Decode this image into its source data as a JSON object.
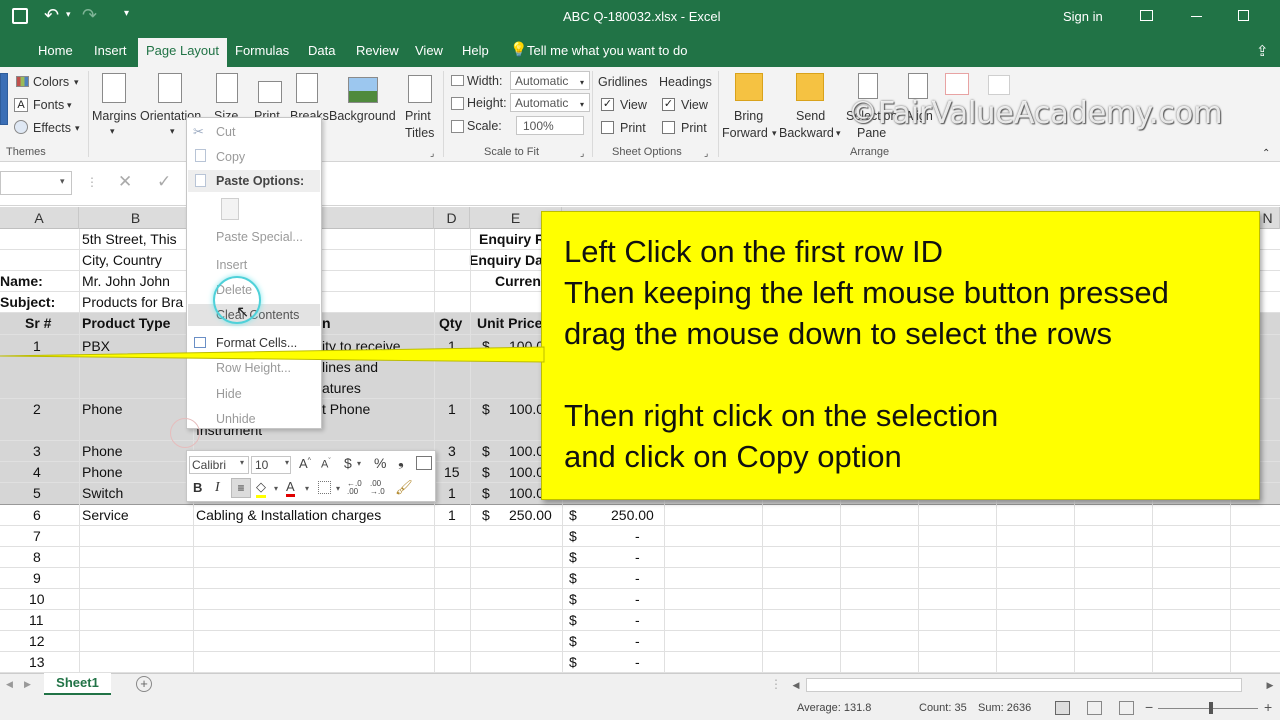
{
  "window": {
    "title": "ABC Q-180032.xlsx  -  Excel",
    "sign_in": "Sign in"
  },
  "tabs": [
    "Home",
    "Insert",
    "Page Layout",
    "Formulas",
    "Data",
    "Review",
    "View",
    "Help"
  ],
  "tell_me": "Tell me what you want to do",
  "ribbon": {
    "themes": {
      "colors": "Colors",
      "fonts": "Fonts",
      "effects": "Effects",
      "group": "Themes"
    },
    "page_setup": {
      "margins": "Margins",
      "orientation": "Orientation",
      "size": "Size",
      "print_area": "Print",
      "breaks": "Breaks",
      "background": "Background",
      "print_titles_1": "Print",
      "print_titles_2": "Titles"
    },
    "scale": {
      "width_label": "Width:",
      "width_val": "Automatic",
      "height_label": "Height:",
      "height_val": "Automatic",
      "scale_label": "Scale:",
      "scale_val": "100%",
      "group": "Scale to Fit"
    },
    "sheet_options": {
      "gridlines": "Gridlines",
      "headings": "Headings",
      "view": "View",
      "print": "Print",
      "group": "Sheet Options"
    },
    "arrange": {
      "bring_1": "Bring",
      "bring_2": "Forward",
      "send_1": "Send",
      "send_2": "Backward",
      "sel_1": "Selection",
      "sel_2": "Pane",
      "align": "Align",
      "group": "Arrange"
    }
  },
  "watermark": "©FairValueAcademy.com",
  "columns": [
    "A",
    "B",
    "D",
    "E",
    "N"
  ],
  "rows": {
    "r1": {
      "b": "5th Street, This",
      "e": "Enquiry R"
    },
    "r2": {
      "b": "City, Country",
      "e": "Enquiry Da"
    },
    "r3": {
      "a": "Name:",
      "b": "Mr. John John",
      "e": "Curren"
    },
    "r4": {
      "a": "Subject:",
      "b": "Products for Bra"
    },
    "hdr": {
      "a": "Sr #",
      "b": "Product Type",
      "c": "n",
      "d": "Qty",
      "e": "Unit Price"
    },
    "items": [
      {
        "sr": "1",
        "type": "PBX",
        "desc1": "ity to receive",
        "desc2": "lines and",
        "desc3": "atures",
        "qty": "1",
        "cur": "$",
        "price": "100.0"
      },
      {
        "sr": "2",
        "type": "Phone",
        "desc1": "t Phone",
        "desc2": "Instrument",
        "qty": "1",
        "cur": "$",
        "price": "100.00"
      },
      {
        "sr": "3",
        "type": "Phone",
        "qty": "3",
        "cur": "$",
        "price": "100.00"
      },
      {
        "sr": "4",
        "type": "Phone",
        "qty": "15",
        "cur": "$",
        "price": "100.00"
      },
      {
        "sr": "5",
        "type": "Switch",
        "qty": "1",
        "cur": "$",
        "price": "100.00"
      },
      {
        "sr": "6",
        "type": "Service",
        "desc": "Cabling & Installation charges",
        "qty": "1",
        "cur": "$",
        "price": "250.00",
        "tcur": "$",
        "total": "250.00"
      }
    ],
    "empty": [
      {
        "sr": "7",
        "cur": "$",
        "total": "-"
      },
      {
        "sr": "8",
        "cur": "$",
        "total": "-"
      },
      {
        "sr": "9",
        "cur": "$",
        "total": "-"
      },
      {
        "sr": "10",
        "cur": "$",
        "total": "-"
      },
      {
        "sr": "11",
        "cur": "$",
        "total": "-"
      },
      {
        "sr": "12",
        "cur": "$",
        "total": "-"
      },
      {
        "sr": "13",
        "cur": "$",
        "total": "-"
      }
    ]
  },
  "context_menu": {
    "cut": "Cut",
    "copy": "Copy",
    "paste_options": "Paste Options:",
    "paste_special": "Paste Special...",
    "insert": "Insert",
    "delete": "Delete",
    "clear_contents": "Clear Contents",
    "format_cells": "Format Cells...",
    "row_height": "Row Height...",
    "hide": "Hide",
    "unhide": "Unhide"
  },
  "mini_toolbar": {
    "font": "Calibri",
    "size": "10",
    "bold": "B",
    "italic": "I",
    "currency": "$",
    "percent": "%"
  },
  "callout": {
    "line1": "Left Click on the first row ID",
    "line2": "Then keeping the left mouse button pressed",
    "line3": "drag the mouse down to select the rows",
    "line4": "Then right click on the selection",
    "line5": "and click on Copy option"
  },
  "sheet_tab": "Sheet1",
  "status": {
    "average": "Average: 131.8",
    "count": "Count: 35",
    "sum": "Sum: 2636"
  }
}
